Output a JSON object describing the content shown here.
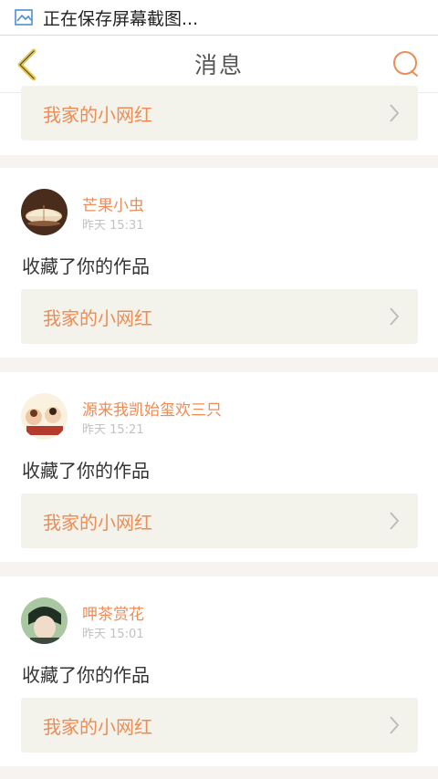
{
  "status_bar": {
    "icon": "image-icon",
    "text": "正在保存屏幕截图..."
  },
  "nav": {
    "title": "消息",
    "back_icon": "chevron-left-icon",
    "search_icon": "search-icon"
  },
  "colors": {
    "accent": "#ef8b54",
    "back_icon": "#e9c74a",
    "link_bg": "#f3f3ec",
    "page_bg": "#f6f3f1"
  },
  "top_item": {
    "link_label": "我家的小网红"
  },
  "items": [
    {
      "name": "芒果小虫",
      "time": "昨天 15:31",
      "action": "收藏了你的作品",
      "link_label": "我家的小网红"
    },
    {
      "name": "源来我凯始玺欢三只",
      "time": "昨天 15:21",
      "action": "收藏了你的作品",
      "link_label": "我家的小网红"
    },
    {
      "name": "呷茶赏花",
      "time": "昨天 15:01",
      "action": "收藏了你的作品",
      "link_label": "我家的小网红"
    }
  ]
}
